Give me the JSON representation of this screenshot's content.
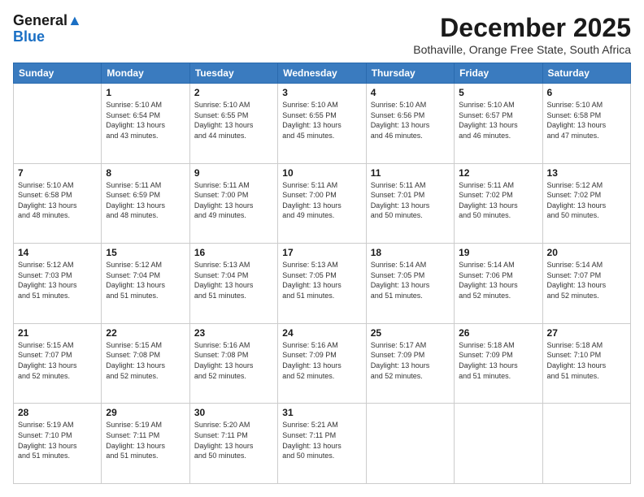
{
  "logo": {
    "line1": "General",
    "line2": "Blue"
  },
  "title": "December 2025",
  "subtitle": "Bothaville, Orange Free State, South Africa",
  "days_of_week": [
    "Sunday",
    "Monday",
    "Tuesday",
    "Wednesday",
    "Thursday",
    "Friday",
    "Saturday"
  ],
  "weeks": [
    [
      {
        "day": "",
        "info": ""
      },
      {
        "day": "1",
        "info": "Sunrise: 5:10 AM\nSunset: 6:54 PM\nDaylight: 13 hours\nand 43 minutes."
      },
      {
        "day": "2",
        "info": "Sunrise: 5:10 AM\nSunset: 6:55 PM\nDaylight: 13 hours\nand 44 minutes."
      },
      {
        "day": "3",
        "info": "Sunrise: 5:10 AM\nSunset: 6:55 PM\nDaylight: 13 hours\nand 45 minutes."
      },
      {
        "day": "4",
        "info": "Sunrise: 5:10 AM\nSunset: 6:56 PM\nDaylight: 13 hours\nand 46 minutes."
      },
      {
        "day": "5",
        "info": "Sunrise: 5:10 AM\nSunset: 6:57 PM\nDaylight: 13 hours\nand 46 minutes."
      },
      {
        "day": "6",
        "info": "Sunrise: 5:10 AM\nSunset: 6:58 PM\nDaylight: 13 hours\nand 47 minutes."
      }
    ],
    [
      {
        "day": "7",
        "info": "Sunrise: 5:10 AM\nSunset: 6:58 PM\nDaylight: 13 hours\nand 48 minutes."
      },
      {
        "day": "8",
        "info": "Sunrise: 5:11 AM\nSunset: 6:59 PM\nDaylight: 13 hours\nand 48 minutes."
      },
      {
        "day": "9",
        "info": "Sunrise: 5:11 AM\nSunset: 7:00 PM\nDaylight: 13 hours\nand 49 minutes."
      },
      {
        "day": "10",
        "info": "Sunrise: 5:11 AM\nSunset: 7:00 PM\nDaylight: 13 hours\nand 49 minutes."
      },
      {
        "day": "11",
        "info": "Sunrise: 5:11 AM\nSunset: 7:01 PM\nDaylight: 13 hours\nand 50 minutes."
      },
      {
        "day": "12",
        "info": "Sunrise: 5:11 AM\nSunset: 7:02 PM\nDaylight: 13 hours\nand 50 minutes."
      },
      {
        "day": "13",
        "info": "Sunrise: 5:12 AM\nSunset: 7:02 PM\nDaylight: 13 hours\nand 50 minutes."
      }
    ],
    [
      {
        "day": "14",
        "info": "Sunrise: 5:12 AM\nSunset: 7:03 PM\nDaylight: 13 hours\nand 51 minutes."
      },
      {
        "day": "15",
        "info": "Sunrise: 5:12 AM\nSunset: 7:04 PM\nDaylight: 13 hours\nand 51 minutes."
      },
      {
        "day": "16",
        "info": "Sunrise: 5:13 AM\nSunset: 7:04 PM\nDaylight: 13 hours\nand 51 minutes."
      },
      {
        "day": "17",
        "info": "Sunrise: 5:13 AM\nSunset: 7:05 PM\nDaylight: 13 hours\nand 51 minutes."
      },
      {
        "day": "18",
        "info": "Sunrise: 5:14 AM\nSunset: 7:05 PM\nDaylight: 13 hours\nand 51 minutes."
      },
      {
        "day": "19",
        "info": "Sunrise: 5:14 AM\nSunset: 7:06 PM\nDaylight: 13 hours\nand 52 minutes."
      },
      {
        "day": "20",
        "info": "Sunrise: 5:14 AM\nSunset: 7:07 PM\nDaylight: 13 hours\nand 52 minutes."
      }
    ],
    [
      {
        "day": "21",
        "info": "Sunrise: 5:15 AM\nSunset: 7:07 PM\nDaylight: 13 hours\nand 52 minutes."
      },
      {
        "day": "22",
        "info": "Sunrise: 5:15 AM\nSunset: 7:08 PM\nDaylight: 13 hours\nand 52 minutes."
      },
      {
        "day": "23",
        "info": "Sunrise: 5:16 AM\nSunset: 7:08 PM\nDaylight: 13 hours\nand 52 minutes."
      },
      {
        "day": "24",
        "info": "Sunrise: 5:16 AM\nSunset: 7:09 PM\nDaylight: 13 hours\nand 52 minutes."
      },
      {
        "day": "25",
        "info": "Sunrise: 5:17 AM\nSunset: 7:09 PM\nDaylight: 13 hours\nand 52 minutes."
      },
      {
        "day": "26",
        "info": "Sunrise: 5:18 AM\nSunset: 7:09 PM\nDaylight: 13 hours\nand 51 minutes."
      },
      {
        "day": "27",
        "info": "Sunrise: 5:18 AM\nSunset: 7:10 PM\nDaylight: 13 hours\nand 51 minutes."
      }
    ],
    [
      {
        "day": "28",
        "info": "Sunrise: 5:19 AM\nSunset: 7:10 PM\nDaylight: 13 hours\nand 51 minutes."
      },
      {
        "day": "29",
        "info": "Sunrise: 5:19 AM\nSunset: 7:11 PM\nDaylight: 13 hours\nand 51 minutes."
      },
      {
        "day": "30",
        "info": "Sunrise: 5:20 AM\nSunset: 7:11 PM\nDaylight: 13 hours\nand 50 minutes."
      },
      {
        "day": "31",
        "info": "Sunrise: 5:21 AM\nSunset: 7:11 PM\nDaylight: 13 hours\nand 50 minutes."
      },
      {
        "day": "",
        "info": ""
      },
      {
        "day": "",
        "info": ""
      },
      {
        "day": "",
        "info": ""
      }
    ]
  ]
}
